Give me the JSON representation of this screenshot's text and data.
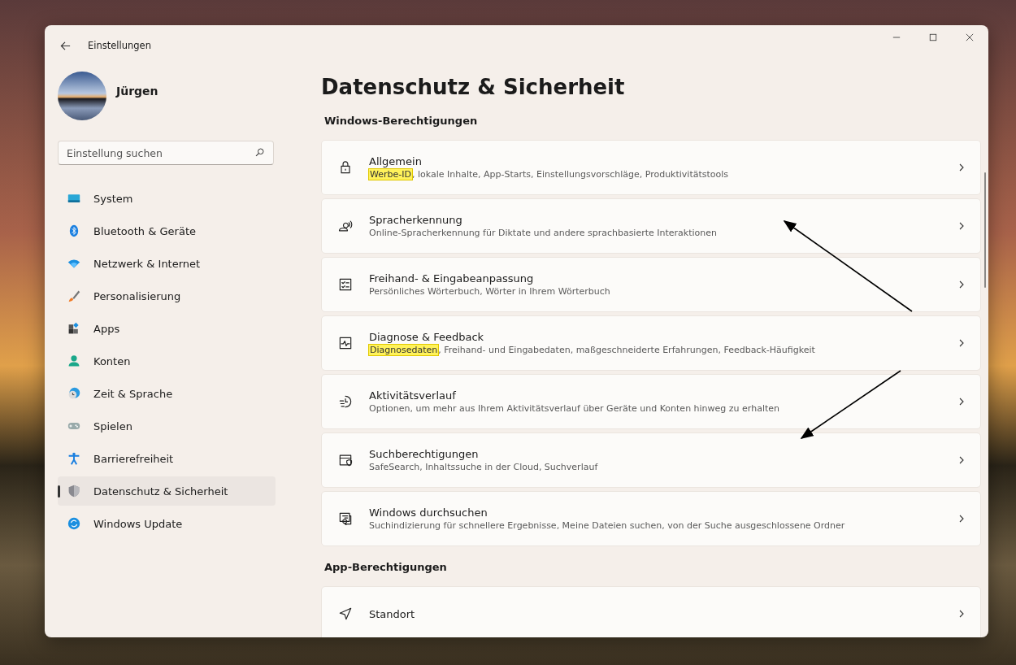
{
  "window": {
    "title": "Einstellungen"
  },
  "user": {
    "name": "Jürgen"
  },
  "search": {
    "placeholder": "Einstellung suchen"
  },
  "sidebar": {
    "items": [
      {
        "label": "System",
        "selected": false
      },
      {
        "label": "Bluetooth & Geräte",
        "selected": false
      },
      {
        "label": "Netzwerk & Internet",
        "selected": false
      },
      {
        "label": "Personalisierung",
        "selected": false
      },
      {
        "label": "Apps",
        "selected": false
      },
      {
        "label": "Konten",
        "selected": false
      },
      {
        "label": "Zeit & Sprache",
        "selected": false
      },
      {
        "label": "Spielen",
        "selected": false
      },
      {
        "label": "Barrierefreiheit",
        "selected": false
      },
      {
        "label": "Datenschutz & Sicherheit",
        "selected": true
      },
      {
        "label": "Windows Update",
        "selected": false
      }
    ]
  },
  "page": {
    "title": "Datenschutz & Sicherheit"
  },
  "sections": [
    {
      "heading": "Windows-Berechtigungen",
      "cards": [
        {
          "title": "Allgemein",
          "highlight": "Werbe-ID",
          "description": ", lokale Inhalte, App-Starts, Einstellungsvorschläge, Produktivitätstools"
        },
        {
          "title": "Spracherkennung",
          "description": "Online-Spracherkennung für Diktate und andere sprachbasierte Interaktionen"
        },
        {
          "title": "Freihand- & Eingabeanpassung",
          "description": "Persönliches Wörterbuch, Wörter in Ihrem Wörterbuch"
        },
        {
          "title": "Diagnose & Feedback",
          "highlight": "Diagnosedaten",
          "description": ", Freihand- und Eingabedaten, maßgeschneiderte Erfahrungen, Feedback-Häufigkeit"
        },
        {
          "title": "Aktivitätsverlauf",
          "description": "Optionen, um mehr aus Ihrem Aktivitätsverlauf über Geräte und Konten hinweg zu erhalten"
        },
        {
          "title": "Suchberechtigungen",
          "description": "SafeSearch, Inhaltssuche in der Cloud, Suchverlauf"
        },
        {
          "title": "Windows durchsuchen",
          "description": "Suchindizierung für schnellere Ergebnisse, Meine Dateien suchen, von der Suche ausgeschlossene Ordner"
        }
      ]
    },
    {
      "heading": "App-Berechtigungen",
      "cards": [
        {
          "title": "Standort"
        }
      ]
    }
  ]
}
